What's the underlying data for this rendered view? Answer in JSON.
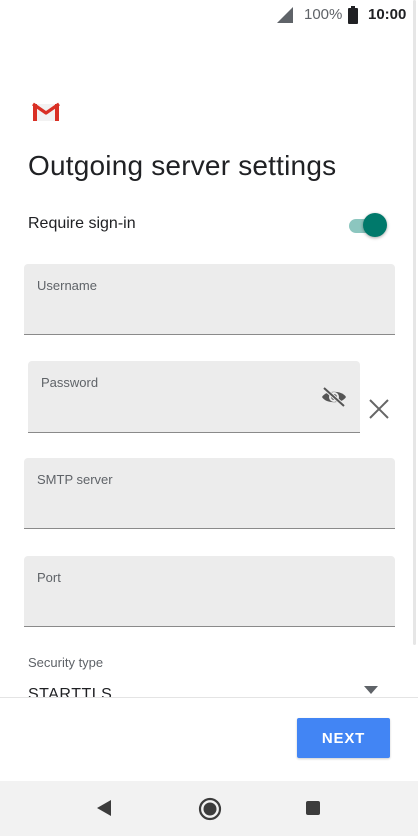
{
  "status_bar": {
    "battery_percent": "100%",
    "time": "10:00",
    "icons": [
      "cell-signal-icon",
      "battery-icon"
    ]
  },
  "app": {
    "logo": "gmail-logo"
  },
  "page": {
    "title": "Outgoing server settings"
  },
  "require_signin": {
    "label": "Require sign-in",
    "enabled": true
  },
  "fields": {
    "username": {
      "label": "Username",
      "value": ""
    },
    "password": {
      "label": "Password",
      "value": "",
      "icons": [
        "visibility-off-icon",
        "close-icon"
      ]
    },
    "smtp_server": {
      "label": "SMTP server",
      "value": ""
    },
    "port": {
      "label": "Port",
      "value": ""
    }
  },
  "security": {
    "label": "Security type",
    "value": "STARTTLS"
  },
  "actions": {
    "next_label": "NEXT"
  },
  "nav": {
    "icons": [
      "back-icon",
      "home-icon",
      "recents-icon"
    ]
  },
  "colors": {
    "accent": "#00796b",
    "accent_track": "#8cc6bf",
    "button": "#4285f4",
    "field_bg": "#ececec"
  }
}
